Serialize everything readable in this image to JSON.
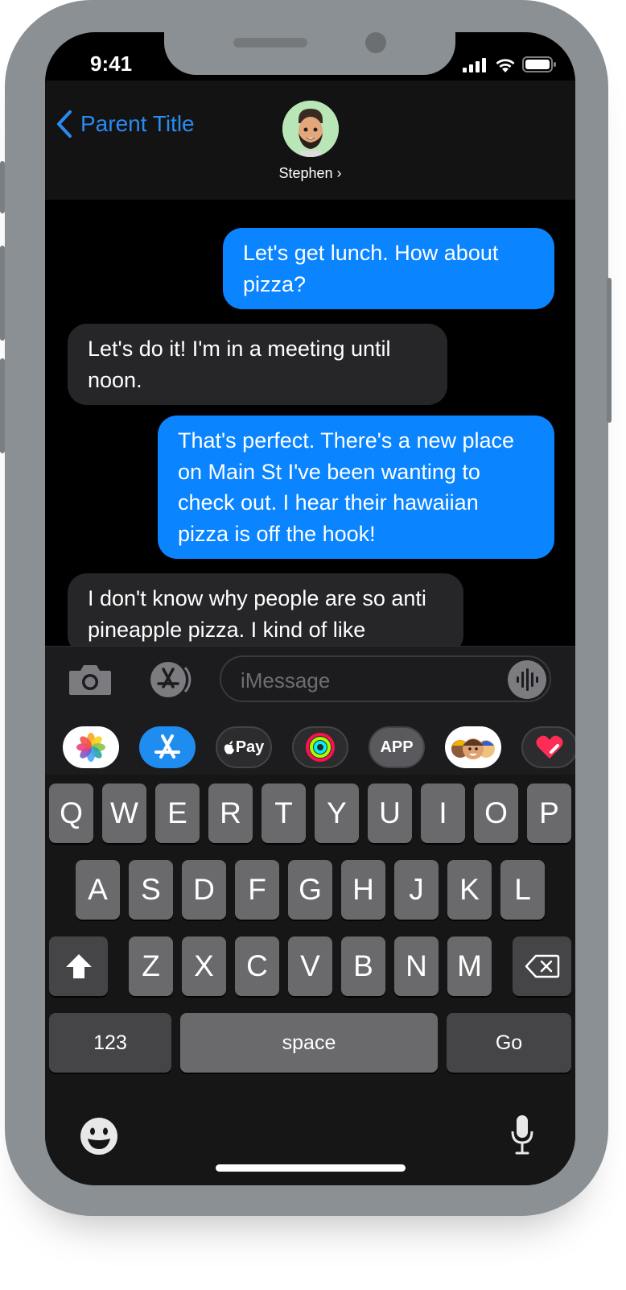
{
  "status": {
    "time": "9:41"
  },
  "nav": {
    "back_label": "Parent Title",
    "contact_name": "Stephen ›"
  },
  "messages": [
    {
      "from": "me",
      "text": "Let's get lunch. How about pizza?"
    },
    {
      "from": "them",
      "text": "Let's do it! I'm in a meeting until noon."
    },
    {
      "from": "me",
      "text": "That's perfect. There's a new place on Main St I've been wanting to check out. I hear their hawaiian pizza is off the hook!"
    },
    {
      "from": "them",
      "text": "I don't know why people are so anti pineapple pizza. I kind of like"
    }
  ],
  "composer": {
    "placeholder": "iMessage"
  },
  "app_strip": {
    "app_store_label": "APP",
    "apple_pay_label": "Pay"
  },
  "keyboard": {
    "row1": [
      "Q",
      "W",
      "E",
      "R",
      "T",
      "Y",
      "U",
      "I",
      "O",
      "P"
    ],
    "row2": [
      "A",
      "S",
      "D",
      "F",
      "G",
      "H",
      "J",
      "K",
      "L"
    ],
    "row3": [
      "Z",
      "X",
      "C",
      "V",
      "B",
      "N",
      "M"
    ],
    "numbers": "123",
    "space": "space",
    "go": "Go"
  },
  "colors": {
    "accent": "#0a84ff",
    "link": "#2a8bf2",
    "incoming": "#262628",
    "background": "#000000",
    "frame": "#8b9094"
  },
  "icons": [
    "back-chevron-icon",
    "camera-icon",
    "app-store-icon",
    "audio-waveform-icon",
    "photos-icon",
    "apple-pay-icon",
    "activity-icon",
    "memoji-icon",
    "digital-touch-icon",
    "shift-icon",
    "delete-icon",
    "emoji-icon",
    "microphone-icon",
    "signal-icon",
    "wifi-icon",
    "battery-icon"
  ]
}
